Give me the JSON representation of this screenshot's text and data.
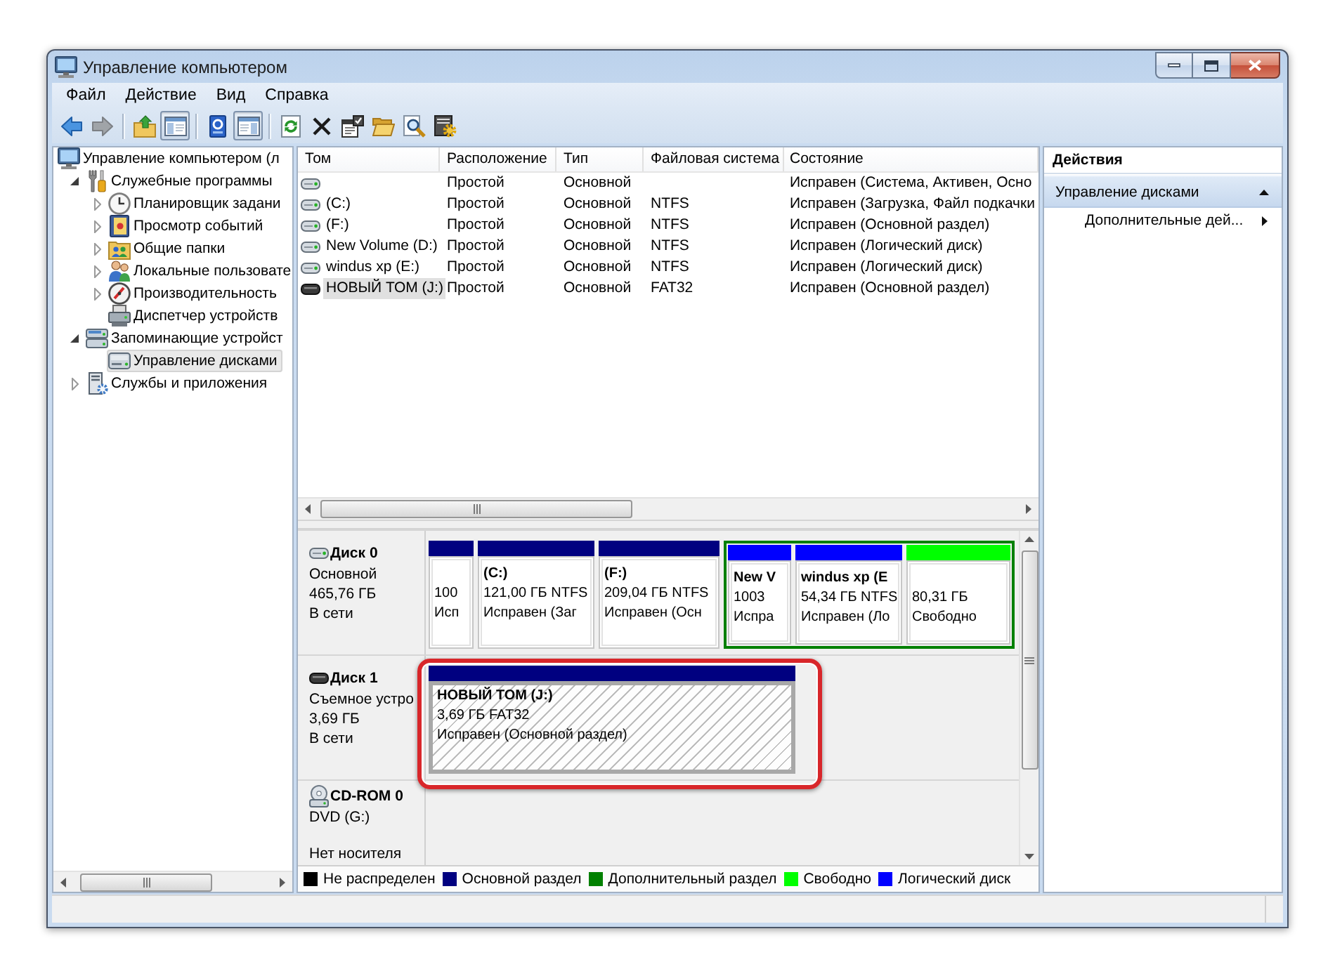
{
  "window": {
    "title": "Управление компьютером"
  },
  "menu": [
    "Файл",
    "Действие",
    "Вид",
    "Справка"
  ],
  "toolbar": [
    {
      "kind": "back",
      "pressed": false,
      "disabled": false
    },
    {
      "kind": "forward",
      "pressed": false,
      "disabled": true
    },
    {
      "kind": "separator"
    },
    {
      "kind": "up",
      "pressed": false,
      "disabled": false
    },
    {
      "kind": "console-tree",
      "pressed": true,
      "disabled": false
    },
    {
      "kind": "separator"
    },
    {
      "kind": "help",
      "pressed": false,
      "disabled": false
    },
    {
      "kind": "action-pane",
      "pressed": true,
      "disabled": false
    },
    {
      "kind": "separator"
    },
    {
      "kind": "refresh",
      "pressed": false,
      "disabled": false
    },
    {
      "kind": "delete",
      "pressed": false,
      "disabled": false
    },
    {
      "kind": "properties",
      "pressed": false,
      "disabled": false
    },
    {
      "kind": "open",
      "pressed": false,
      "disabled": false
    },
    {
      "kind": "search",
      "pressed": false,
      "disabled": false
    },
    {
      "kind": "settings",
      "pressed": false,
      "disabled": false
    }
  ],
  "tree": [
    {
      "label": "Управление компьютером (л",
      "kind": "computer",
      "selected": false,
      "children": [
        {
          "label": "Служебные программы",
          "kind": "tools",
          "expanded": true,
          "selected": false,
          "children": [
            {
              "label": "Планировщик задани",
              "kind": "clock",
              "expanded": false,
              "selected": false
            },
            {
              "label": "Просмотр событий",
              "kind": "log",
              "expanded": false,
              "selected": false
            },
            {
              "label": "Общие папки",
              "kind": "shared",
              "expanded": false,
              "selected": false
            },
            {
              "label": "Локальные пользовате",
              "kind": "users",
              "expanded": false,
              "selected": false
            },
            {
              "label": "Производительность",
              "kind": "performance",
              "expanded": false,
              "selected": false
            },
            {
              "label": "Диспетчер устройств",
              "kind": "devices",
              "selected": false
            }
          ]
        },
        {
          "label": "Запоминающие устройст",
          "kind": "storage",
          "expanded": true,
          "selected": false,
          "children": [
            {
              "label": "Управление дисками",
              "kind": "disk",
              "selected": true
            }
          ]
        },
        {
          "label": "Службы и приложения",
          "kind": "services",
          "expanded": false,
          "selected": false
        }
      ]
    }
  ],
  "volumes": {
    "columns": [
      "Том",
      "Расположение",
      "Тип",
      "Файловая система",
      "Состояние"
    ],
    "rows": [
      {
        "kind": "fixed",
        "layout": "Простой",
        "type": "Основной",
        "status": "Исправен (Система, Активен, Осно",
        "selected": false
      },
      {
        "kind": "fixed",
        "volume": "(C:)",
        "layout": "Простой",
        "type": "Основной",
        "file_system": "NTFS",
        "status": "Исправен (Загрузка, Файл подкачки",
        "selected": false
      },
      {
        "kind": "fixed",
        "volume": "(F:)",
        "layout": "Простой",
        "type": "Основной",
        "file_system": "NTFS",
        "status": "Исправен (Основной раздел)",
        "selected": false
      },
      {
        "kind": "fixed",
        "volume": "New Volume (D:)",
        "layout": "Простой",
        "type": "Основной",
        "file_system": "NTFS",
        "status": "Исправен (Логический диск)",
        "selected": false
      },
      {
        "kind": "fixed",
        "volume": "windus xp (E:)",
        "layout": "Простой",
        "type": "Основной",
        "file_system": "NTFS",
        "status": "Исправен (Логический диск)",
        "selected": false
      },
      {
        "kind": "removable",
        "volume": "НОВЫЙ ТОМ (J:)",
        "layout": "Простой",
        "type": "Основной",
        "file_system": "FAT32",
        "status": "Исправен (Основной раздел)",
        "selected": true
      }
    ]
  },
  "disks": [
    {
      "kind": "basic",
      "name": "Диск 0",
      "type": "Основной",
      "size": "465,76 ГБ",
      "state": "В сети",
      "partitions": [
        {
          "color": "#000080",
          "selected": false,
          "highlighted": false,
          "size": "100",
          "status": "Исп"
        },
        {
          "color": "#000080",
          "selected": false,
          "highlighted": false,
          "name": "(C:)",
          "size": "121,00 ГБ NTFS",
          "status": "Исправен (Заг"
        },
        {
          "color": "#000080",
          "selected": false,
          "highlighted": false,
          "name": "(F:)",
          "size": "209,04 ГБ NTFS",
          "status": "Исправен (Осн"
        },
        {
          "color": "#008000",
          "selected": false,
          "partitions": [
            {
              "color": "#0000ff",
              "selected": false,
              "highlighted": false,
              "name": "New V",
              "size": "1003",
              "status": "Испра"
            },
            {
              "color": "#0000ff",
              "selected": false,
              "highlighted": false,
              "name": "windus xp (E",
              "size": "54,34 ГБ NTFS",
              "status": "Исправен (Ло"
            },
            {
              "color": "#00ff00",
              "selected": false,
              "highlighted": false,
              "size": "80,31 ГБ",
              "status": "Свободно"
            }
          ]
        }
      ]
    },
    {
      "kind": "removable",
      "name": "Диск 1",
      "type": "Съемное устро",
      "size": "3,69 ГБ",
      "state": "В сети",
      "partitions": [
        {
          "color": "#000080",
          "selected": true,
          "highlighted": true,
          "name": "НОВЫЙ ТОМ (J:)",
          "size": "3,69 ГБ FAT32",
          "status": "Исправен (Основной раздел)"
        }
      ]
    },
    {
      "kind": "cdrom",
      "name": "CD-ROM 0",
      "type": "DVD (G:)",
      "state": "Нет носителя"
    }
  ],
  "legend": [
    {
      "label": "Не распределен",
      "color": "#000000"
    },
    {
      "label": "Основной раздел",
      "color": "#000080"
    },
    {
      "label": "Дополнительный раздел",
      "color": "#008000"
    },
    {
      "label": "Свободно",
      "color": "#00ff00"
    },
    {
      "label": "Логический диск",
      "color": "#0000ff"
    }
  ],
  "actions": {
    "title": "Действия",
    "sections": [
      {
        "label": "Управление дисками",
        "expanded": true,
        "items": [
          {
            "label": "Дополнительные дей...",
            "submenu": true
          }
        ]
      }
    ]
  }
}
